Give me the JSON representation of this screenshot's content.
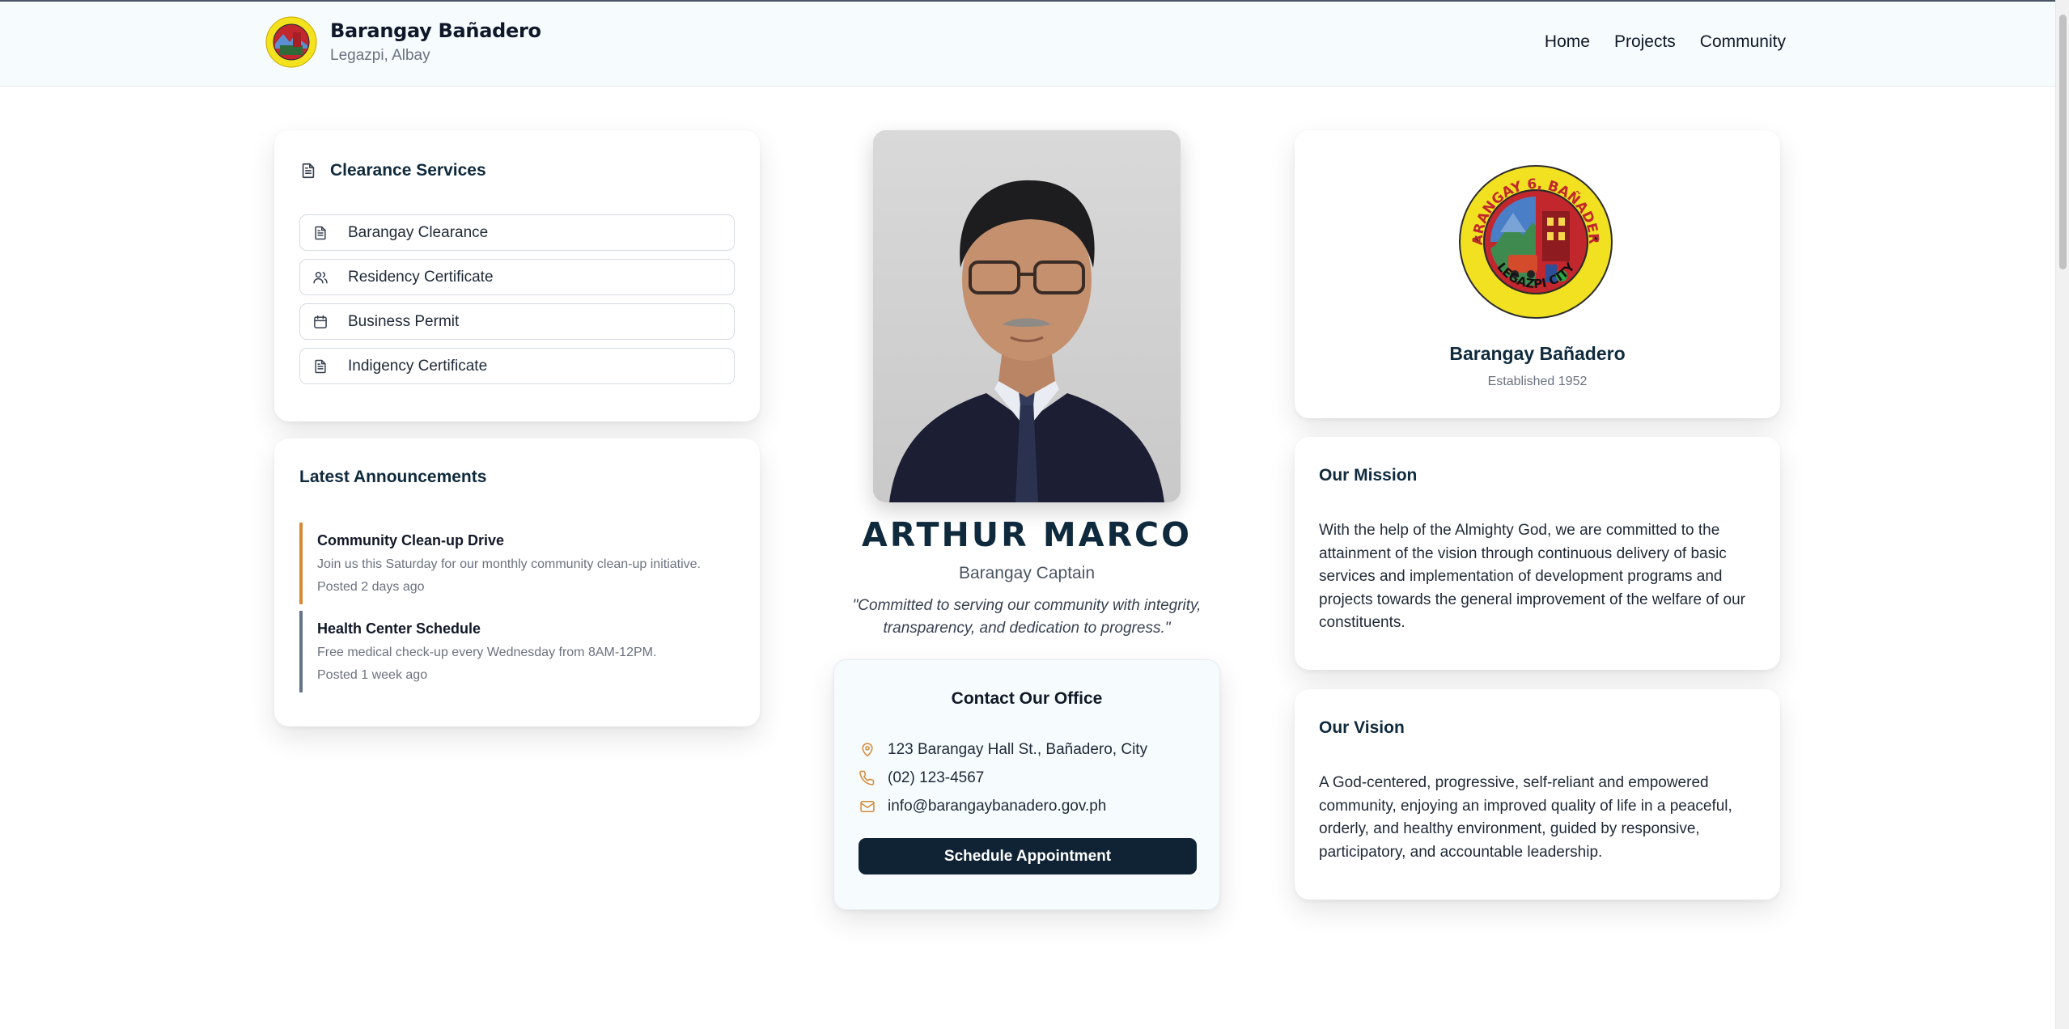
{
  "header": {
    "brand_name": "Barangay Bañadero",
    "brand_location": "Legazpi, Albay",
    "nav": [
      "Home",
      "Projects",
      "Community"
    ]
  },
  "services": {
    "title": "Clearance Services",
    "items": [
      {
        "label": "Barangay Clearance",
        "icon": "document-icon"
      },
      {
        "label": "Residency Certificate",
        "icon": "users-icon"
      },
      {
        "label": "Business Permit",
        "icon": "calendar-icon"
      },
      {
        "label": "Indigency Certificate",
        "icon": "document-icon"
      }
    ]
  },
  "announcements": {
    "title": "Latest Announcements",
    "items": [
      {
        "title": "Community Clean-up Drive",
        "description": "Join us this Saturday for our monthly community clean-up initiative.",
        "posted": "Posted 2 days ago",
        "accent": "#d58a37"
      },
      {
        "title": "Health Center Schedule",
        "description": "Free medical check-up every Wednesday from 8AM-12PM.",
        "posted": "Posted 1 week ago",
        "accent": "#64748b"
      }
    ]
  },
  "captain": {
    "name": "ARTHUR MARCO",
    "role": "Barangay Captain",
    "quote": "\"Committed to serving our community with integrity, transparency, and dedication to progress.\""
  },
  "contact": {
    "title": "Contact Our Office",
    "address": "123 Barangay Hall St., Bañadero, City",
    "phone": "(02) 123-4567",
    "email": "info@barangaybanadero.gov.ph",
    "button": "Schedule Appointment"
  },
  "profile": {
    "name": "Barangay Bañadero",
    "established": "Established 1952",
    "seal_text_top": "BARANGAY 6, BAÑADERO",
    "seal_text_bottom": "LEGAZPI CITY"
  },
  "mission": {
    "title": "Our Mission",
    "text": "With the help of the Almighty God, we are committed to the attainment of the vision through continuous delivery of basic services and implementation of development programs and projects towards the general improvement of the welfare of our constituents."
  },
  "vision": {
    "title": "Our Vision",
    "text": "A God-centered, progressive, self-reliant and empowered community, enjoying an improved quality of life in a peaceful, orderly, and healthy environment, guided by responsive, participatory, and accountable leadership."
  },
  "colors": {
    "accent": "#d58a37",
    "navy": "#0f2a3d",
    "button": "#0f2335"
  }
}
